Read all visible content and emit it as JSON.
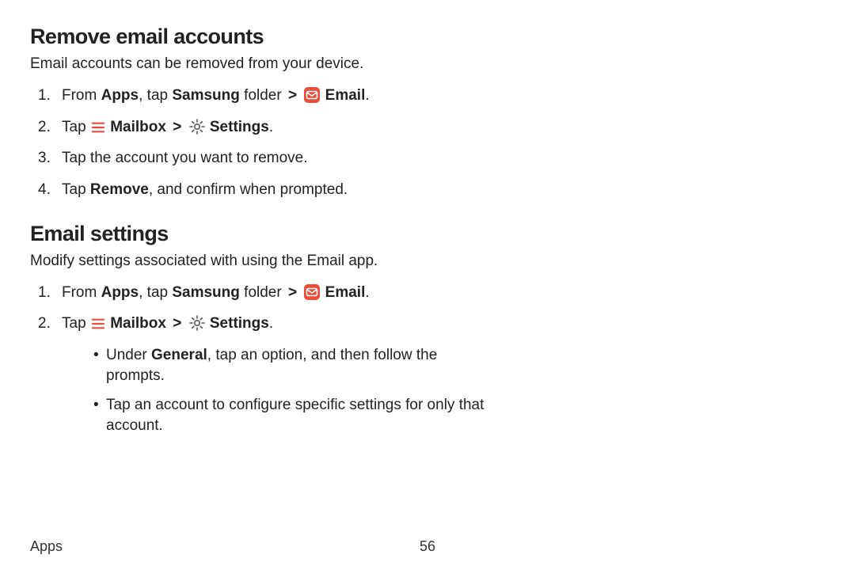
{
  "sections": {
    "remove": {
      "heading": "Remove email accounts",
      "intro": "Email accounts can be removed from your device.",
      "step1": {
        "prefix": "From ",
        "apps": "Apps",
        "mid1": ", tap ",
        "samsung": "Samsung",
        "mid2": " folder ",
        "chev": ">",
        "email": " Email",
        "suffix": "."
      },
      "step2": {
        "prefix": "Tap ",
        "mailbox": " Mailbox ",
        "chev": ">",
        "settings": " Settings",
        "suffix": "."
      },
      "step3": "Tap the account you want to remove.",
      "step4": {
        "prefix": "Tap ",
        "remove": "Remove",
        "suffix": ", and confirm when prompted."
      }
    },
    "settings": {
      "heading": "Email settings",
      "intro": "Modify settings associated with using the Email app.",
      "step1": {
        "prefix": "From ",
        "apps": "Apps",
        "mid1": ", tap ",
        "samsung": "Samsung",
        "mid2": " folder ",
        "chev": ">",
        "email": " Email",
        "suffix": "."
      },
      "step2": {
        "prefix": "Tap ",
        "mailbox": " Mailbox ",
        "chev": ">",
        "settings": " Settings",
        "suffix": "."
      },
      "sub1": {
        "prefix": "Under ",
        "general": "General",
        "suffix": ", tap an option, and then follow the prompts."
      },
      "sub2": "Tap an account to configure specific settings for only that account."
    }
  },
  "footer": {
    "section": "Apps",
    "page": "56"
  },
  "icons": {
    "email": "email-icon",
    "mailbox": "mailbox-icon",
    "settings": "settings-icon"
  },
  "colors": {
    "accent_red": "#e94e3a",
    "icon_line": "#555"
  }
}
